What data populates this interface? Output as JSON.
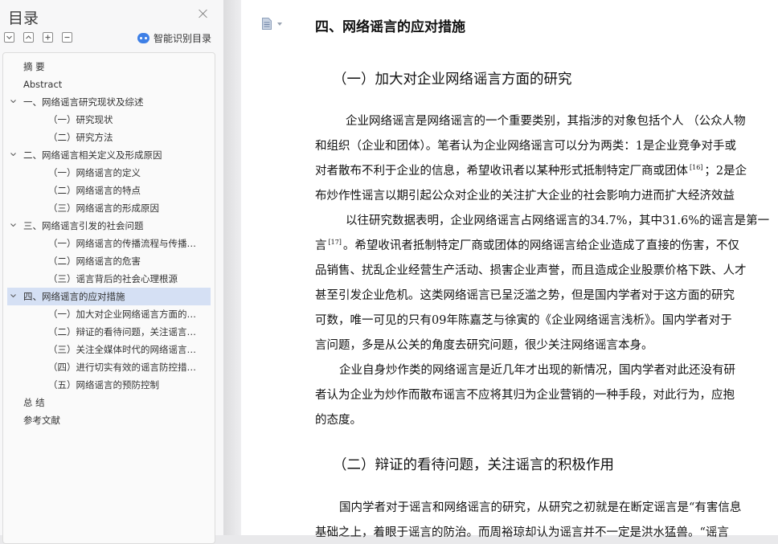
{
  "toc": {
    "title": "目录",
    "smart_label": "智能识别目录",
    "items": [
      {
        "label": "摘    要",
        "level": 0,
        "expandable": false,
        "active": false
      },
      {
        "label": "Abstract",
        "level": 0,
        "expandable": false,
        "active": false
      },
      {
        "label": "一、网络谣言研究现状及综述",
        "level": 1,
        "expandable": true,
        "active": false
      },
      {
        "label": "（一）研究现状",
        "level": 2,
        "expandable": false,
        "active": false
      },
      {
        "label": "（二）研究方法",
        "level": 2,
        "expandable": false,
        "active": false
      },
      {
        "label": "二、网络谣言相关定义及形成原因",
        "level": 1,
        "expandable": true,
        "active": false
      },
      {
        "label": "（一）网络谣言的定义",
        "level": 2,
        "expandable": false,
        "active": false
      },
      {
        "label": "（二）网络谣言的特点",
        "level": 2,
        "expandable": false,
        "active": false
      },
      {
        "label": "（三）网络谣言的形成原因",
        "level": 2,
        "expandable": false,
        "active": false
      },
      {
        "label": "三、网络谣言引发的社会问题",
        "level": 1,
        "expandable": true,
        "active": false
      },
      {
        "label": "（一）网络谣言的传播流程与传播…",
        "level": 2,
        "expandable": false,
        "active": false
      },
      {
        "label": "（二）网络谣言的危害",
        "level": 2,
        "expandable": false,
        "active": false
      },
      {
        "label": "（三）谣言背后的社会心理根源",
        "level": 2,
        "expandable": false,
        "active": false
      },
      {
        "label": "四、网络谣言的应对措施",
        "level": 1,
        "expandable": true,
        "active": true
      },
      {
        "label": "（一）加大对企业网络谣言方面的…",
        "level": 2,
        "expandable": false,
        "active": false
      },
      {
        "label": "（二）辩证的看待问题，关注谣言…",
        "level": 2,
        "expandable": false,
        "active": false
      },
      {
        "label": "（三）关注全媒体时代的网络谣言…",
        "level": 2,
        "expandable": false,
        "active": false
      },
      {
        "label": "（四）进行切实有效的谣言防控措…",
        "level": 2,
        "expandable": false,
        "active": false
      },
      {
        "label": "（五）网络谣言的预防控制",
        "level": 2,
        "expandable": false,
        "active": false
      },
      {
        "label": "总    结",
        "level": 0,
        "expandable": false,
        "active": false
      },
      {
        "label": "参考文献",
        "level": 0,
        "expandable": false,
        "active": false
      }
    ]
  },
  "doc": {
    "h1": "四、网络谣言的应对措施",
    "h2a": "（一）加大对企业网络谣言方面的研究",
    "h2b": "（二）辩证的看待问题，关注谣言的积极作用",
    "lines": {
      "l1": "企业网络谣言是网络谣言的一个重要类别，其指涉的对象包括个人 （公众人物",
      "l2": "和组织（企业和团体）。笔者认为企业网络谣言可以分为两类：1是企业竞争对手或",
      "l3a": "对者散布不利于企业的信息，希望收讯者以某种形式抵制特定厂商或团体",
      "l3ref": "[16]",
      "l3b": "；2是企",
      "l4": "布炒作性谣言以期引起公众对企业的关注扩大企业的社会影响力进而扩大经济效益",
      "l5": "以往研究数据表明，企业网络谣言占网络谣言的34.7%，其中31.6%的谣言是第一",
      "l6a": "言",
      "l6ref": "[17]",
      "l6b": "。希望收讯者抵制特定厂商或团体的网络谣言给企业造成了直接的伤害，不仅",
      "l7": "品销售、扰乱企业经营生产活动、损害企业声誉，而且造成企业股票价格下跌、人才",
      "l8": "甚至引发企业危机。这类网络谣言已呈泛滥之势，但是国内学者对于这方面的研究",
      "l9": "可数，唯一可见的只有09年陈嘉芝与徐寅的《企业网络谣言浅析》。国内学者对于",
      "l10": "言问题，多是从公关的角度去研究问题，很少关注网络谣言本身。",
      "l11": "企业自身炒作类的网络谣言是近几年才出现的新情况，国内学者对此还没有研",
      "l12": "者认为企业为炒作而散布谣言不应将其归为企业营销的一种手段，对此行为，应抱",
      "l13": "的态度。",
      "l14": "国内学者对于谣言和网络谣言的研究，从研究之初就是在断定谣言是“有害信息",
      "l15": "基础之上，着眼于谣言的防治。而周裕琼却认为谣言并不一定是洪水猛兽。“谣言"
    }
  }
}
